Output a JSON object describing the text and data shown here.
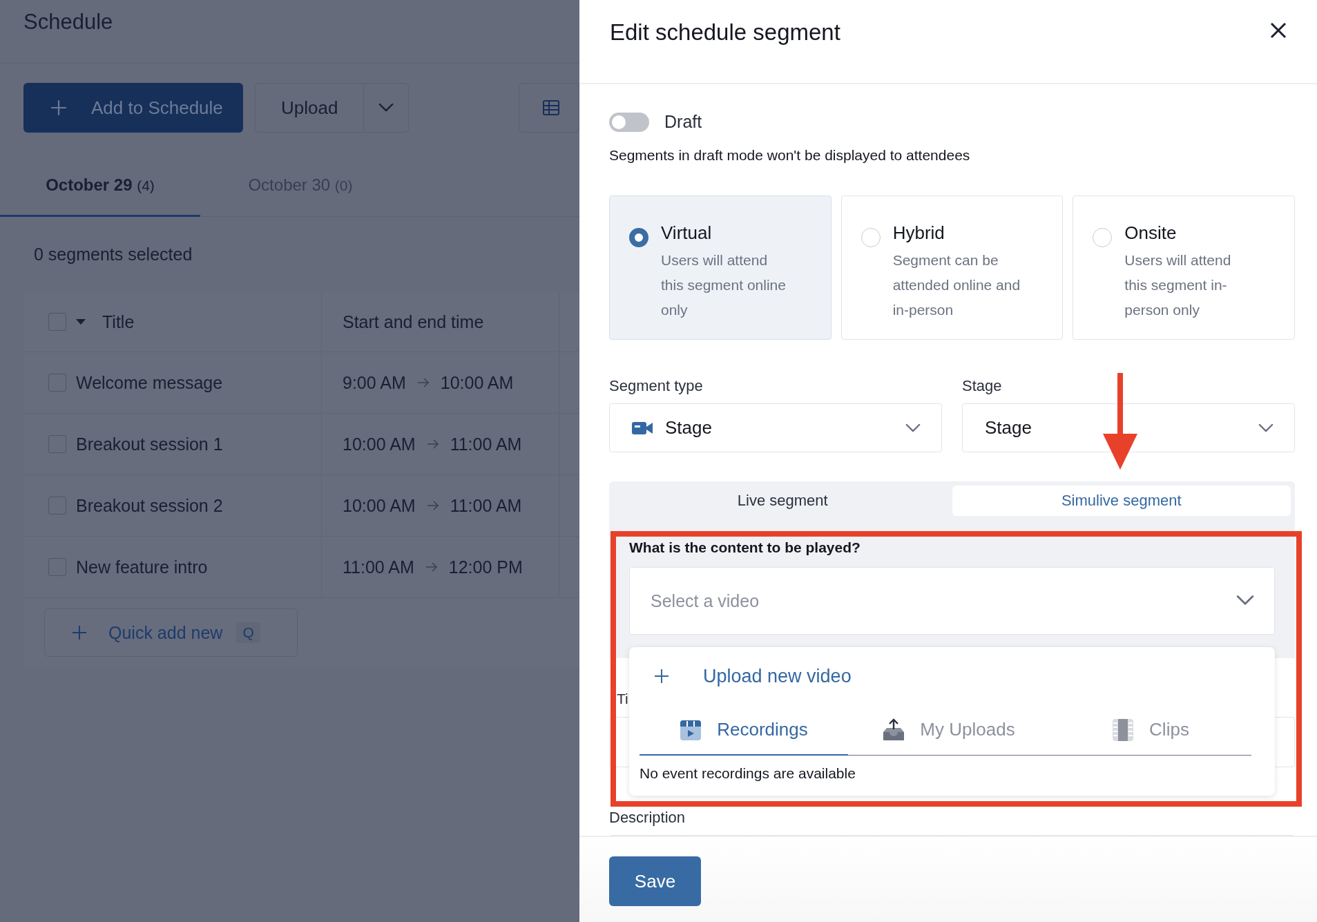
{
  "schedule": {
    "title": "Schedule",
    "add_button": "Add to Schedule",
    "upload_button": "Upload",
    "date_tabs": [
      {
        "label": "October 29",
        "count": "(4)",
        "selected": true
      },
      {
        "label": "October 30",
        "count": "(0)",
        "selected": false
      }
    ],
    "selection_status": "0 segments selected",
    "select_all_checked": false,
    "columns": [
      "Title",
      "Start and end time"
    ],
    "rows": [
      {
        "title": "Welcome message",
        "start": "9:00 AM",
        "end": "10:00 AM",
        "checked": false
      },
      {
        "title": "Breakout session 1",
        "start": "10:00 AM",
        "end": "11:00 AM",
        "checked": false
      },
      {
        "title": "Breakout session 2",
        "start": "10:00 AM",
        "end": "11:00 AM",
        "checked": false
      },
      {
        "title": "New feature intro",
        "start": "11:00 AM",
        "end": "12:00 PM",
        "checked": false
      }
    ],
    "quick_add": {
      "label": "Quick add new",
      "shortcut": "Q"
    }
  },
  "panel": {
    "title": "Edit schedule segment",
    "draft": {
      "label": "Draft",
      "on": false
    },
    "draft_note": "Segments in draft mode won't be displayed to attendees",
    "attendance_options": [
      {
        "label": "Virtual",
        "description": "Users will attend this segment online only",
        "selected": true
      },
      {
        "label": "Hybrid",
        "description": "Segment can be attended online and in-person",
        "selected": false
      },
      {
        "label": "Onsite",
        "description": "Users will attend this segment in-person only",
        "selected": false
      }
    ],
    "segment_type": {
      "label": "Segment type",
      "value": "Stage"
    },
    "stage": {
      "label": "Stage",
      "value": "Stage"
    },
    "mode_tabs": [
      {
        "label": "Live segment",
        "selected": false
      },
      {
        "label": "Simulive segment",
        "selected": true
      }
    ],
    "content_question": "What is the content to be played?",
    "video_select": {
      "placeholder": "Select a video"
    },
    "video_menu": {
      "upload_label": "Upload new video",
      "tabs": [
        {
          "kind": "recordings",
          "label": "Recordings",
          "selected": true
        },
        {
          "kind": "uploads",
          "label": "My Uploads",
          "selected": false
        },
        {
          "kind": "clips",
          "label": "Clips",
          "selected": false
        }
      ],
      "empty_message": "No event recordings are available"
    },
    "title_label": "Ti",
    "description_label": "Description",
    "save_button": "Save"
  }
}
